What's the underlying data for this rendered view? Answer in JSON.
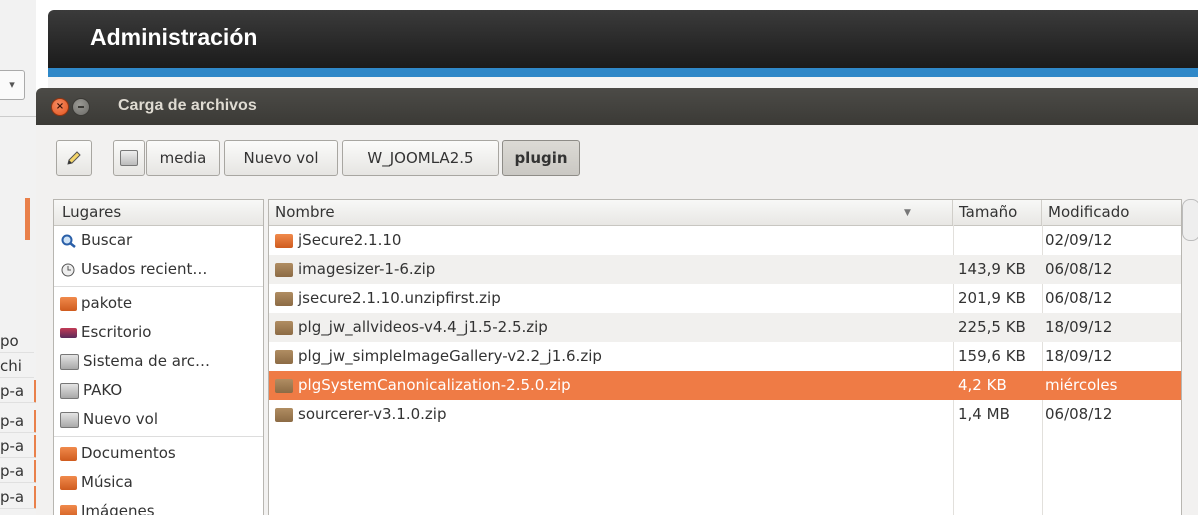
{
  "browser": {
    "title": "Administración",
    "left_clip_rows": [
      "po",
      "chi",
      "p-a",
      "p-a",
      "p-a",
      "p-a",
      "p-a"
    ]
  },
  "dialog": {
    "title": "Carga de archivos",
    "path": [
      "media",
      "Nuevo vol",
      "W_JOOMLA2.5",
      "plugin"
    ]
  },
  "places": {
    "header": "Lugares",
    "items": [
      {
        "label": "Buscar",
        "icon": "search-icon"
      },
      {
        "label": "Usados recient…",
        "icon": "recent-icon"
      },
      {
        "label": "pakote",
        "icon": "home-folder-icon"
      },
      {
        "label": "Escritorio",
        "icon": "desktop-icon"
      },
      {
        "label": "Sistema de arc…",
        "icon": "drive-icon"
      },
      {
        "label": "PAKO",
        "icon": "drive-icon"
      },
      {
        "label": "Nuevo vol",
        "icon": "drive-icon"
      },
      {
        "label": "Documentos",
        "icon": "documents-folder-icon"
      },
      {
        "label": "Música",
        "icon": "music-folder-icon"
      },
      {
        "label": "Imágenes",
        "icon": "pictures-folder-icon"
      }
    ]
  },
  "files": {
    "headers": {
      "name": "Nombre",
      "size": "Tamaño",
      "modified": "Modificado"
    },
    "rows": [
      {
        "name": "jSecure2.1.10",
        "size": "",
        "modified": "02/09/12",
        "type": "folder"
      },
      {
        "name": "imagesizer-1-6.zip",
        "size": "143,9 KB",
        "modified": "06/08/12",
        "type": "zip"
      },
      {
        "name": "jsecure2.1.10.unzipfirst.zip",
        "size": "201,9 KB",
        "modified": "06/08/12",
        "type": "zip"
      },
      {
        "name": "plg_jw_allvideos-v4.4_j1.5-2.5.zip",
        "size": "225,5 KB",
        "modified": "18/09/12",
        "type": "zip"
      },
      {
        "name": "plg_jw_simpleImageGallery-v2.2_j1.6.zip",
        "size": "159,6 KB",
        "modified": "18/09/12",
        "type": "zip"
      },
      {
        "name": "plgSystemCanonicalization-2.5.0.zip",
        "size": "4,2 KB",
        "modified": "miércoles",
        "type": "zip",
        "selected": true
      },
      {
        "name": "sourcerer-v3.1.0.zip",
        "size": "1,4 MB",
        "modified": "06/08/12",
        "type": "zip"
      }
    ]
  },
  "colors": {
    "selection": "#ef7b45",
    "titlebar": "#3b3a36",
    "accent_blue": "#2f88c8"
  }
}
